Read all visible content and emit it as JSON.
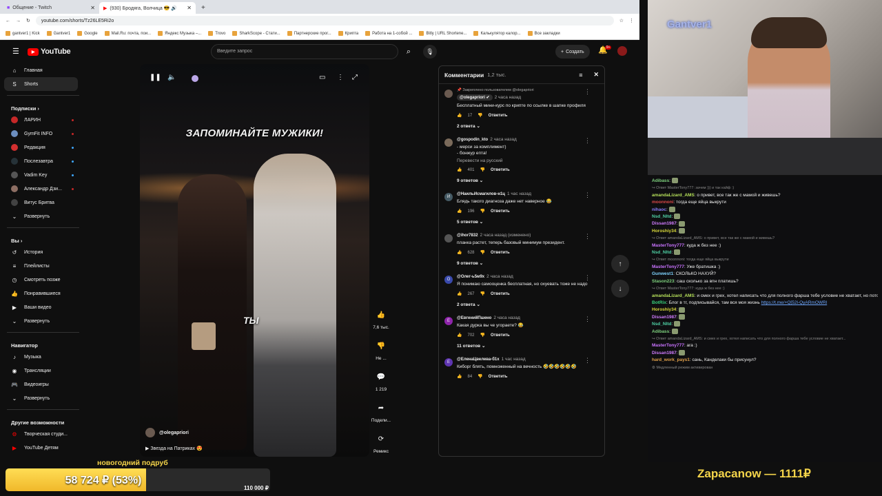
{
  "browser": {
    "tabs": [
      {
        "title": "Общение - Twitch"
      },
      {
        "title": "(930) Бродяга, Волчица 😎 🔊"
      }
    ],
    "url": "youtube.com/shorts/Tz26LE5Ri2o",
    "bookmarks": [
      "gantver1 | Kick",
      "Gantver1",
      "Google",
      "Mail.Ru: почта, пои...",
      "Яндекс Музыка –...",
      "Trovo",
      "SharkScope - Стати...",
      "Партнерские прог...",
      "Крипта",
      "Работа на 1-собой ...",
      "Bitly | URL Shortene...",
      "Калькулятор калор...",
      "Все закладки"
    ]
  },
  "header": {
    "logo": "YouTube",
    "search_placeholder": "Введите запрос",
    "create_label": "Создать",
    "notif_count": "9+"
  },
  "sidebar": {
    "main": [
      {
        "label": "Главная",
        "icon": "home-icon"
      },
      {
        "label": "Shorts",
        "icon": "shorts-icon"
      }
    ],
    "subs_title": "Подписки",
    "subs": [
      {
        "label": "ЛАРИН",
        "color": "#c62828"
      },
      {
        "label": "GymFit INFO",
        "color": "#6c8ebf"
      },
      {
        "label": "Редакция",
        "color": "#d32f2f"
      },
      {
        "label": "Послезавтра",
        "color": "#263238"
      },
      {
        "label": "Vadim Key",
        "color": "#555555"
      },
      {
        "label": "Александр Дзи...",
        "color": "#8d6e63"
      },
      {
        "label": "Витус Бритва",
        "color": "#424242"
      }
    ],
    "expand_label": "Развернуть",
    "you_title": "Вы",
    "you": [
      {
        "label": "История",
        "icon": "history-icon"
      },
      {
        "label": "Плейлисты",
        "icon": "playlist-icon"
      },
      {
        "label": "Смотреть позже",
        "icon": "clock-icon"
      },
      {
        "label": "Понравившиеся",
        "icon": "like-icon"
      },
      {
        "label": "Ваши видео",
        "icon": "video-icon"
      },
      {
        "label": "Развернуть",
        "icon": "chevron-down-icon"
      }
    ],
    "nav_title": "Навигатор",
    "nav": [
      {
        "label": "Музыка",
        "icon": "music-icon"
      },
      {
        "label": "Трансляции",
        "icon": "live-icon"
      },
      {
        "label": "Видеоигры",
        "icon": "game-icon"
      },
      {
        "label": "Развернуть",
        "icon": "chevron-down-icon"
      }
    ],
    "other_title": "Другие возможности",
    "other": [
      {
        "label": "Творческая студи...",
        "icon": "studio-icon"
      },
      {
        "label": "YouTube Детям",
        "icon": "kids-icon"
      }
    ]
  },
  "video": {
    "caption": "ЗАПОМИНАЙТЕ МУЖИКИ!",
    "subtitle": "ТЫ",
    "channel": "@olegapriori",
    "title": "▶ Звезда на Патриках 😍"
  },
  "actions": [
    {
      "label": "7,6 тыс.",
      "icon": "thumb-up-icon"
    },
    {
      "label": "Не ...",
      "icon": "thumb-down-icon"
    },
    {
      "label": "1 219",
      "icon": "comment-icon"
    },
    {
      "label": "Подели...",
      "icon": "share-icon"
    },
    {
      "label": "Ремикс",
      "icon": "remix-icon"
    }
  ],
  "comments": {
    "title": "Комментарии",
    "count": "1,2 тыс.",
    "items": [
      {
        "pinned": "📌 Закреплено пользователем @olegapriori",
        "user": "@olegapriori ✔",
        "time": "2 часа назад",
        "text": "Бесплатный мини-курс по крипте по ссылке в шапке профиля",
        "likes": "17",
        "replies": "2 ответа",
        "color": "#6a5a50"
      },
      {
        "user": "@gospodin_kto",
        "time": "2 часа назад",
        "text": "- мерси за комплимент)\n- бонжур епта!",
        "translate": "Перевести на русский",
        "likes": "401",
        "replies": "9 ответов",
        "color": "#7a6a5a"
      },
      {
        "user": "@НаильИсмагилов-н1ц",
        "time": "1 час назад",
        "text": "Блядь такого диагноза даже нет наверное 😂",
        "likes": "196",
        "replies": "5 ответов",
        "color": "#455a64",
        "initial": "И"
      },
      {
        "user": "@ihor7832",
        "time": "2 часа назад (изменено)",
        "text": "планка растет, теперь базовый минимум президент.",
        "likes": "628",
        "replies": "9 ответов",
        "color": "#555555"
      },
      {
        "user": "@Олег-ь5м9х",
        "time": "2 часа назад",
        "text": "Я понимаю самооценка бесплатная, но охуевать тоже не надо",
        "likes": "267",
        "replies": "2 ответа",
        "color": "#3949ab",
        "initial": "О"
      },
      {
        "user": "@ЕвгенийПшено",
        "time": "2 часа назад",
        "text": "Какая дурка вы че угораете? 😂",
        "likes": "702",
        "replies": "11 ответов",
        "color": "#8e24aa",
        "initial": "Е"
      },
      {
        "user": "@ЕленаЦвелева-б1х",
        "time": "1 час назад",
        "text": "Киборг блять, помноженный на вечность 🤣🤣🤣🤣🤣🤣",
        "likes": "84",
        "color": "#5e35b1",
        "initial": "Е"
      }
    ],
    "reply_label": "Ответить"
  },
  "webcam": {
    "name": "Gantver1"
  },
  "chat": [
    {
      "user": "Adibass",
      "color": "#7fd37f",
      "text": "",
      "emote": true
    },
    {
      "reply": true,
      "text": "↪ Ответ MasterTony777: зачем ))) и так кайф :)"
    },
    {
      "user": "amandaLizard_AMS",
      "color": "#b5e05a",
      "text": "о привет, все так же с мамой и живешь?"
    },
    {
      "user": "moonnoni",
      "color": "#e04a4a",
      "text": "тогда еще яйца выкрути"
    },
    {
      "user": "nihaoc",
      "color": "#8a7dff",
      "text": "",
      "emote": true
    },
    {
      "user": "Nsd_Nltd",
      "color": "#4fd1a5",
      "text": "",
      "emote": true
    },
    {
      "user": "Dissan1987",
      "color": "#d17cff",
      "text": "",
      "emote": true
    },
    {
      "user": "Horoshiy34",
      "color": "#d9d93a",
      "text": "",
      "emote": true
    },
    {
      "reply": true,
      "text": "↪ Ответ amandaLizard_AMS: о привет, все так же с мамой и живешь?"
    },
    {
      "user": "MasterTony777",
      "color": "#c973ff",
      "text": "кудa ж без нее :)"
    },
    {
      "user": "Nsd_Nltd",
      "color": "#4fd1a5",
      "text": "",
      "emote": true
    },
    {
      "reply": true,
      "text": "↪ Ответ moonnoni: тогда еще яйца выкрути"
    },
    {
      "user": "MasterTony777",
      "color": "#c973ff",
      "text": "Уже братишка :)"
    },
    {
      "user": "Gunwest1",
      "color": "#7fd3ff",
      "text": "СКОЛЬКО НАХУЙ?"
    },
    {
      "user": "Stason223",
      "color": "#7fd37f",
      "text": "саш сколько за впн платишь?"
    },
    {
      "reply": true,
      "text": "↪ Ответ MasterTony777: кудa ж без нее :)"
    },
    {
      "user": "amandaLizard_AMS",
      "color": "#b5e05a",
      "text": "и смех и грех, хотел написать что для полного фарша тебе условие не хватает, но потом вспомнил что была)"
    },
    {
      "user": "BotRix",
      "color": "#3ad17c",
      "text": "Блог в тг, подписывайся, там вся моя жизнь ",
      "link": "https://t.me/+Q[52l-QyARmOWRl"
    },
    {
      "user": "Horoshiy34",
      "color": "#d9d93a",
      "text": "",
      "emote": true
    },
    {
      "user": "Dissan1987",
      "color": "#d17cff",
      "text": "",
      "emote": true
    },
    {
      "user": "Nsd_Nltd",
      "color": "#4fd1a5",
      "text": "",
      "emote": true
    },
    {
      "user": "Adibass",
      "color": "#7fd37f",
      "text": "",
      "emote": true
    },
    {
      "reply": true,
      "text": "↪ Ответ amandaLizard_AMS: и смех и грех, хотел написать что для полного фарша тебе условие не хватает..."
    },
    {
      "user": "MasterTony777",
      "color": "#c973ff",
      "text": "ага :)"
    },
    {
      "user": "Dissan1987",
      "color": "#d17cff",
      "text": "",
      "emote": true
    },
    {
      "user": "hard_work_pays1",
      "color": "#e0a04a",
      "text": "сань, Канделаки бы присунул?"
    },
    {
      "reply": true,
      "text": "⚙ Медленный режим активирован"
    }
  ],
  "goal": {
    "title": "новогодний подруб",
    "current": "58 724 ₽ (53%)",
    "max": "110 000 ₽",
    "progress": 0.53,
    "color": "#f4c430"
  },
  "donor": "Zapacanow — 1111₽"
}
